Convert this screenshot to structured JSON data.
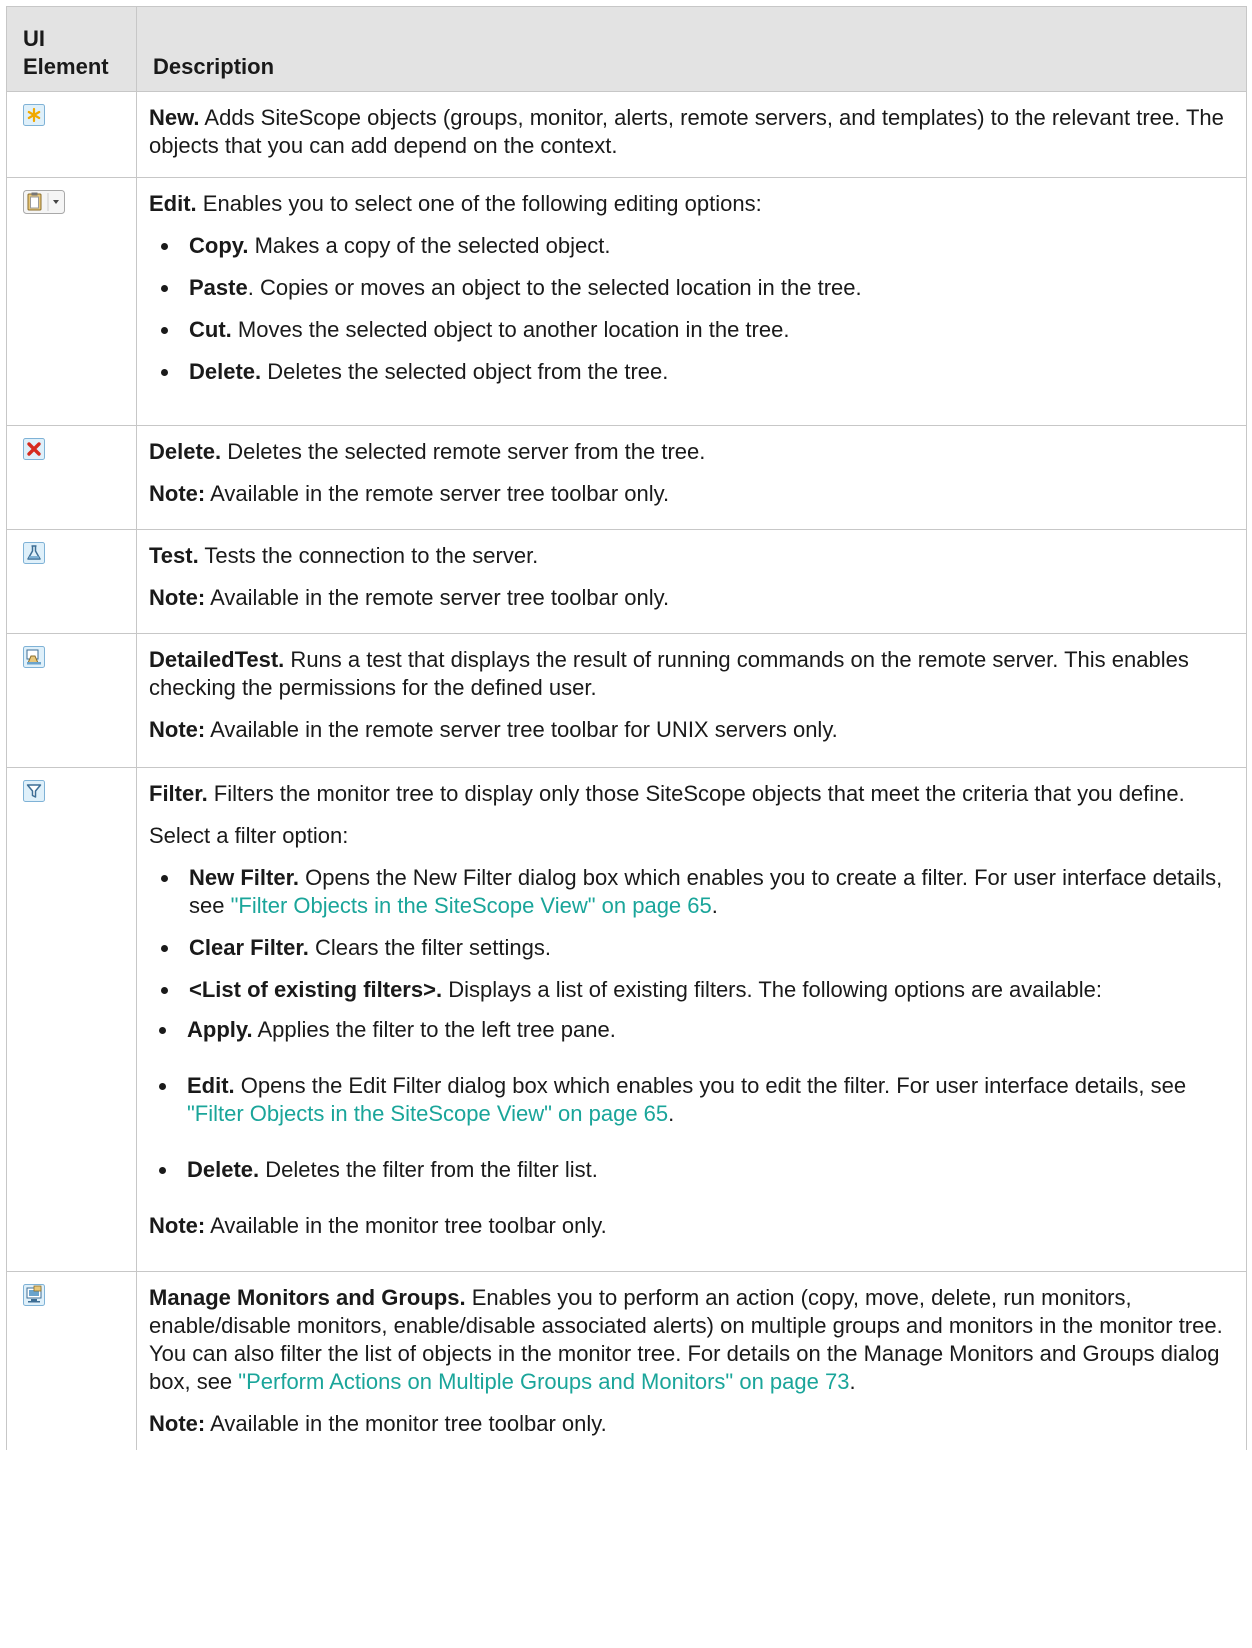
{
  "header": {
    "col1": "UI\nElement",
    "col1_line1": "UI",
    "col1_line2": "Element",
    "col2": "Description"
  },
  "rows": [
    {
      "icon": "new-star-icon",
      "title": "New.",
      "text": " Adds SiteScope objects (groups, monitor, alerts, remote servers, and templates) to the relevant tree. The objects that you can add depend on the context."
    },
    {
      "icon": "clipboard-dropdown-icon",
      "title": "Edit.",
      "text": " Enables you to select one of the following editing options:",
      "options": [
        {
          "title": "Copy.",
          "text": " Makes a copy of the selected object."
        },
        {
          "title": "Paste",
          "text": ". Copies or moves an object to the selected location in the tree."
        },
        {
          "title": "Cut.",
          "text": " Moves the selected object to another location in the tree."
        },
        {
          "title": "Delete.",
          "text": " Deletes the selected object from the tree."
        }
      ]
    },
    {
      "icon": "delete-x-icon",
      "title": "Delete.",
      "text": " Deletes the selected remote server from the tree.",
      "note_label": "Note:",
      "note": " Available in the remote server tree toolbar only."
    },
    {
      "icon": "test-flask-icon",
      "title": "Test.",
      "text": " Tests the connection to the server.",
      "note_label": "Note:",
      "note": " Available in the remote server tree toolbar only."
    },
    {
      "icon": "detailed-test-icon",
      "title": "DetailedTest.",
      "text": " Runs a test that displays the result of running commands on the remote server. This enables checking the permissions for the defined user.",
      "note_label": "Note:",
      "note": " Available in the remote server tree toolbar for UNIX servers only."
    },
    {
      "icon": "filter-funnel-icon",
      "title": "Filter.",
      "text": " Filters the monitor tree to display only those SiteScope objects that meet the criteria that you define.",
      "select_text": "Select a filter option:",
      "options": [
        {
          "title": "New Filter.",
          "text": " Opens the New Filter dialog box which enables you to create a filter. For user interface details, see ",
          "link": "\"Filter Objects in the SiteScope View\" on page 65",
          "after": "."
        },
        {
          "title": "Clear Filter.",
          "text": " Clears the filter settings."
        },
        {
          "title": "<List of existing filters>.",
          "text": " Displays a list of existing filters. The following options are available:"
        }
      ],
      "sub_options": [
        {
          "title": "Apply.",
          "text": " Applies the filter to the left tree pane."
        },
        {
          "title": "Edit.",
          "text": " Opens the Edit Filter dialog box which enables you to edit the filter. For user interface details, see ",
          "link": "\"Filter Objects in the SiteScope View\" on page 65",
          "after": "."
        },
        {
          "title": "Delete.",
          "text": " Deletes the filter from the filter list."
        }
      ],
      "note_label": "Note:",
      "note": " Available in the monitor tree toolbar only."
    },
    {
      "icon": "manage-monitors-icon",
      "title": "Manage Monitors and Groups.",
      "text": " Enables you to perform an action (copy, move, delete, run monitors, enable/disable monitors, enable/disable associated alerts) on multiple groups and monitors in the monitor tree. You can also filter the list of objects in the monitor tree. For details on the Manage Monitors and Groups dialog box, see ",
      "link": "\"Perform Actions on Multiple Groups and Monitors\" on page 73",
      "after": ".",
      "note_label": "Note:",
      "note": " Available in the monitor tree toolbar only."
    }
  ]
}
